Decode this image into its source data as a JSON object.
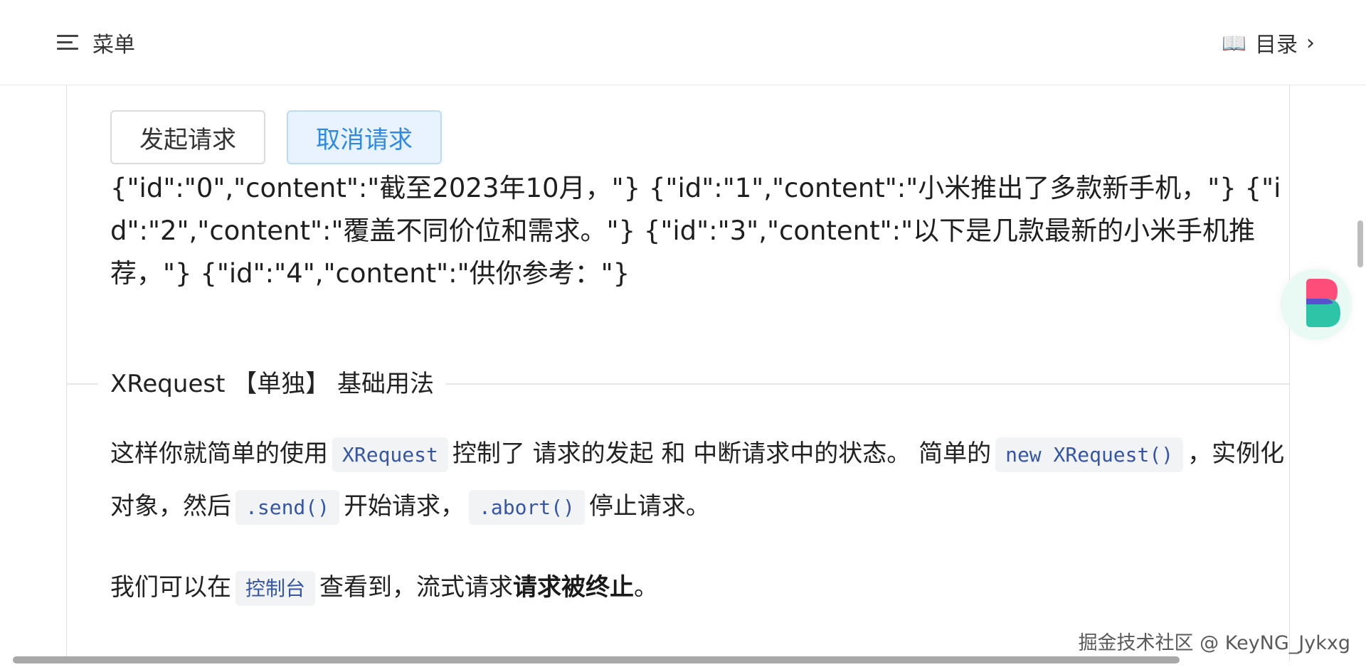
{
  "header": {
    "menu_label": "菜单",
    "toc_label": "目录",
    "toc_chevron": "›",
    "book_icon_glyph": "📖"
  },
  "demo": {
    "start_button": "发起请求",
    "cancel_button": "取消请求",
    "output_text": "{\"id\":\"0\",\"content\":\"截至2023年10月，\"} {\"id\":\"1\",\"content\":\"小米推出了多款新手机，\"} {\"id\":\"2\",\"content\":\"覆盖不同价位和需求。\"} {\"id\":\"3\",\"content\":\"以下是几款最新的小米手机推荐，\"} {\"id\":\"4\",\"content\":\"供你参考：\"}"
  },
  "section": {
    "title": "XRequest 【单独】 基础用法"
  },
  "paragraph1": {
    "t1": "这样你就简单的使用",
    "c1": "XRequest",
    "t2": "控制了 请求的发起 和 中断请求中的状态。 简单的",
    "c2": "new XRequest()",
    "t3": "，实例化对象，然后",
    "c3": ".send()",
    "t4": "开始请求，",
    "c4": ".abort()",
    "t5": "停止请求。"
  },
  "paragraph2": {
    "t1": "我们可以在",
    "c1": "控制台",
    "t2": "查看到，流式请求",
    "strong": "请求被终止",
    "t3": "。"
  },
  "watermark": "掘金技术社区 @ KeyNG_Jykxg",
  "colors": {
    "accent_blue": "#2f8ae6",
    "code_text": "#3455a8",
    "code_bg": "#f2f3f5",
    "cancel_bg": "#e8f3ff"
  }
}
